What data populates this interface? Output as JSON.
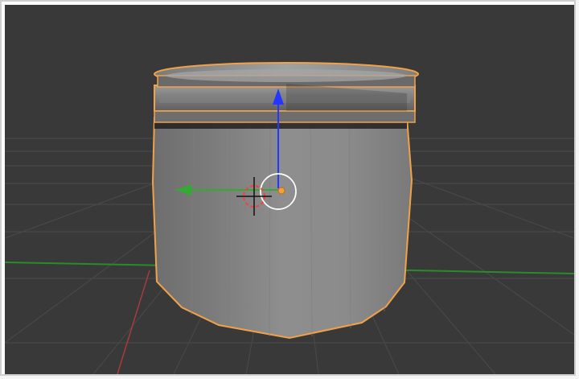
{
  "app": {
    "viewport": {
      "object": "Cylinder"
    },
    "colors": {
      "background": "#393939",
      "grid": "#4a4a4a",
      "axis_x": "#b33b3b",
      "axis_y": "#33aa33",
      "axis_z": "#2436ff",
      "selection": "#f0a24a",
      "mesh": "#8a8a8a"
    },
    "icons": {
      "x_axis": "red-axis-line",
      "y_axis": "green-arrow",
      "z_axis": "blue-arrow",
      "cursor": "3d-cursor",
      "pivot": "origin-dot"
    }
  }
}
